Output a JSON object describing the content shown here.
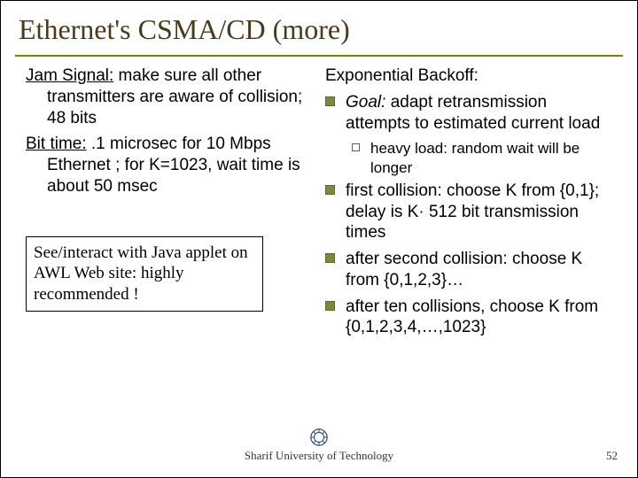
{
  "title": "Ethernet's CSMA/CD (more)",
  "left": {
    "jam_label": "Jam Signal:",
    "jam_text": " make sure all other transmitters are aware of collision; 48 bits",
    "bit_label": "Bit time:",
    "bit_text": " .1 microsec for 10 Mbps Ethernet ; for K=1023, wait time is about 50 msec",
    "box_text": "See/interact with Java applet on AWL Web site: highly recommended !"
  },
  "right": {
    "heading": "Exponential Backoff:",
    "b1_goal": "Goal:",
    "b1_rest": " adapt retransmission attempts to estimated current load",
    "sub1": "heavy load: random wait will be longer",
    "b2": "first collision: choose K from {0,1}; delay is K· 512 bit transmission times",
    "b3": "after second collision: choose K from {0,1,2,3}…",
    "b4": "after ten collisions, choose K from {0,1,2,3,4,…,1023}"
  },
  "footer": "Sharif University of Technology",
  "page": "52"
}
